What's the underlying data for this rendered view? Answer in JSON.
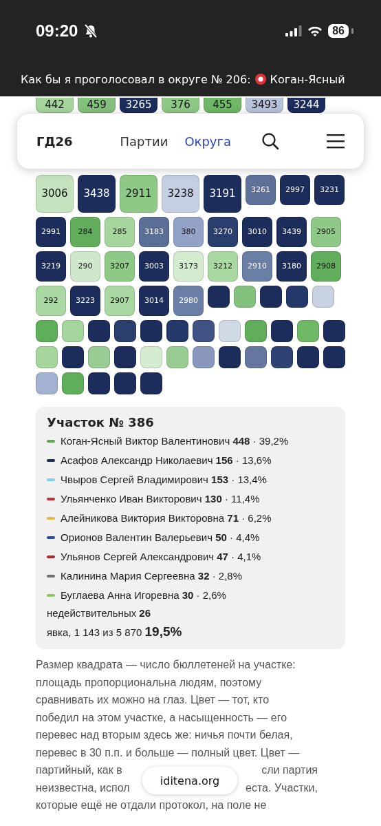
{
  "status_bar": {
    "time": "09:20",
    "battery": "86"
  },
  "page_title": "Как бы я проголосовал в округе № 206: Коган-Ясный",
  "nav": {
    "logo": "ГД26",
    "links": [
      {
        "label": "Партии",
        "selected": false
      },
      {
        "label": "Округа",
        "selected": true
      }
    ]
  },
  "square_rows": [
    [
      {
        "label": "442",
        "color": "#a6d59e",
        "kind": "large"
      },
      {
        "label": "459",
        "color": "#85c17e",
        "kind": "large"
      },
      {
        "label": "3265",
        "color": "#1c2d5c",
        "kind": "large"
      },
      {
        "label": "376",
        "color": "#8fc987",
        "kind": "large"
      },
      {
        "label": "455",
        "color": "#6fb866",
        "kind": "large"
      },
      {
        "label": "3493",
        "color": "#b8c4db",
        "kind": "large"
      },
      {
        "label": "3244",
        "color": "#1c2d5c",
        "kind": "large"
      }
    ],
    [
      {
        "label": "3006",
        "color": "#c6e3c0",
        "kind": "large"
      },
      {
        "label": "3438",
        "color": "#1c2d5c",
        "kind": "large"
      },
      {
        "label": "2911",
        "color": "#8fc987",
        "kind": "large"
      },
      {
        "label": "3238",
        "color": "#c5cfe2",
        "kind": "large"
      },
      {
        "label": "3191",
        "color": "#1c2d5c",
        "kind": "large"
      },
      {
        "label": "3261",
        "color": "#5f7199",
        "kind": "medium"
      },
      {
        "label": "2997",
        "color": "#1c2d5c",
        "kind": "medium"
      },
      {
        "label": "3231",
        "color": "#1c2d5c",
        "kind": "medium"
      }
    ],
    [
      {
        "label": "2991",
        "color": "#1c2d5c",
        "kind": "medium"
      },
      {
        "label": "284",
        "color": "#62ad5c",
        "kind": "medium"
      },
      {
        "label": "285",
        "color": "#a6d59e",
        "kind": "medium"
      },
      {
        "label": "3183",
        "color": "#5a6e96",
        "kind": "medium"
      },
      {
        "label": "380",
        "color": "#93a3c7",
        "kind": "medium"
      },
      {
        "label": "3270",
        "color": "#2a3f6e",
        "kind": "medium"
      },
      {
        "label": "3010",
        "color": "#1c2d5c",
        "kind": "medium"
      },
      {
        "label": "3439",
        "color": "#1c2d5c",
        "kind": "medium"
      },
      {
        "label": "2905",
        "color": "#8fc987",
        "kind": "medium"
      }
    ],
    [
      {
        "label": "3219",
        "color": "#1c2d5c",
        "kind": "medium"
      },
      {
        "label": "290",
        "color": "#cfe8cb",
        "kind": "medium"
      },
      {
        "label": "3207",
        "color": "#8fc987",
        "kind": "medium"
      },
      {
        "label": "3003",
        "color": "#1c2d5c",
        "kind": "medium"
      },
      {
        "label": "3173",
        "color": "#d4ebd0",
        "kind": "medium"
      },
      {
        "label": "3212",
        "color": "#aad8a3",
        "kind": "medium"
      },
      {
        "label": "2910",
        "color": "#6b7ea5",
        "kind": "medium"
      },
      {
        "label": "3180",
        "color": "#1c2d5c",
        "kind": "medium"
      },
      {
        "label": "2908",
        "color": "#62ad5c",
        "kind": "medium"
      }
    ],
    [
      {
        "label": "292",
        "color": "#aad8a3",
        "kind": "medium"
      },
      {
        "label": "3223",
        "color": "#1c2d5c",
        "kind": "medium"
      },
      {
        "label": "2907",
        "color": "#aad8a3",
        "kind": "medium"
      },
      {
        "label": "3014",
        "color": "#1c2d5c",
        "kind": "medium"
      },
      {
        "label": "2980",
        "color": "#6b7ea5",
        "kind": "medium"
      },
      {
        "color": "#1c2d5c",
        "kind": "small"
      },
      {
        "color": "#85c17e",
        "kind": "small"
      },
      {
        "color": "#1c2d5c",
        "kind": "small"
      },
      {
        "color": "#24386a",
        "kind": "small"
      },
      {
        "color": "#c8d2e3",
        "kind": "small"
      }
    ],
    [
      {
        "color": "#5fae5a",
        "kind": "small"
      },
      {
        "color": "#a6d59e",
        "kind": "small"
      },
      {
        "color": "#1c2d5c",
        "kind": "small"
      },
      {
        "color": "#2a3f6e",
        "kind": "small"
      },
      {
        "color": "#1c2d5c",
        "kind": "small"
      },
      {
        "color": "#24386a",
        "kind": "small"
      },
      {
        "color": "#3f5283",
        "kind": "small"
      },
      {
        "color": "#d0d9e6",
        "kind": "small"
      },
      {
        "color": "#62ad5c",
        "kind": "small"
      },
      {
        "color": "#1c2d5c",
        "kind": "small"
      },
      {
        "color": "#6fb866",
        "kind": "small"
      },
      {
        "color": "#1c2d5c",
        "kind": "small"
      }
    ],
    [
      {
        "color": "#a6d59e",
        "kind": "small"
      },
      {
        "color": "#1c2d5c",
        "kind": "small"
      },
      {
        "color": "#99cc92",
        "kind": "small"
      },
      {
        "color": "#1c2d5c",
        "kind": "small"
      },
      {
        "color": "#d4ebd0",
        "kind": "small"
      },
      {
        "color": "#99cc92",
        "kind": "small"
      },
      {
        "color": "#8797bd",
        "kind": "small"
      },
      {
        "color": "#1c2d5c",
        "kind": "small"
      },
      {
        "color": "#6577a0",
        "kind": "small"
      },
      {
        "color": "#2e4374",
        "kind": "small"
      },
      {
        "color": "#1c2d5c",
        "kind": "small"
      },
      {
        "color": "#1c2d5c",
        "kind": "small"
      }
    ],
    [
      {
        "color": "#a3b2d1",
        "kind": "small"
      },
      {
        "color": "#5fae5a",
        "kind": "small"
      },
      {
        "color": "#1c2d5c",
        "kind": "small"
      },
      {
        "color": "#1c2d5c",
        "kind": "small"
      },
      {
        "color": "#1c2d5c",
        "kind": "small"
      }
    ]
  ],
  "precinct": {
    "title": "Участок № 386",
    "candidates": [
      {
        "text": "Коган-Ясный Виктор Валентинович **448** · 39,2%",
        "color": "#5aaa50"
      },
      {
        "text": "Асафов Александр Николаевич **156** · 13,6%",
        "color": "#1c2d5c"
      },
      {
        "text": "Чвыров Сергей Владимирович **153** · 13,4%",
        "color": "#7fd0ea"
      },
      {
        "text": "Ульянченко Иван Викторович **130** · 11,4%",
        "color": "#c8303a"
      },
      {
        "text": "Алейникова Виктория Викторовна **71** · 6,2%",
        "color": "#e8b840"
      },
      {
        "text": "Орионов Валентин Валерьевич **50** · 4,4%",
        "color": "#2a4fa0"
      },
      {
        "text": "Ульянов Сергей Александрович **47** · 4,1%",
        "color": "#b02828"
      },
      {
        "text": "Калинина Мария Сергеевна **32** · 2,8%",
        "color": "#707070"
      },
      {
        "text": "Буглаева Анна Игоревна **30** · 2,6%",
        "color": "#8cc860"
      }
    ],
    "invalid": "недействительных **26**",
    "turnout": "явка, 1 143 из 5 870 **19,5%**"
  },
  "explanation": {
    "lines": [
      [
        "Размер квадрата — число бюллетеней на участке:"
      ],
      [
        "площадь пропорциональна людям, поэтому"
      ],
      [
        "сравнивать их можно на глаз. Цвет — тот, кто"
      ],
      [
        "победил на этом участке, а насыщенность — его"
      ],
      [
        "перевес над вторым здесь же: ничья почти белая,"
      ],
      [
        "перевес в 30 п.п. и больше — полный цвет. Цвет —"
      ],
      [
        "партийный, как в",
        "сли партия"
      ],
      [
        "неизвестна, испол",
        "еста. Участки,"
      ],
      [
        "которые ещё не отдали протокол, на поле не"
      ]
    ]
  },
  "address_pill": "iditena.org"
}
